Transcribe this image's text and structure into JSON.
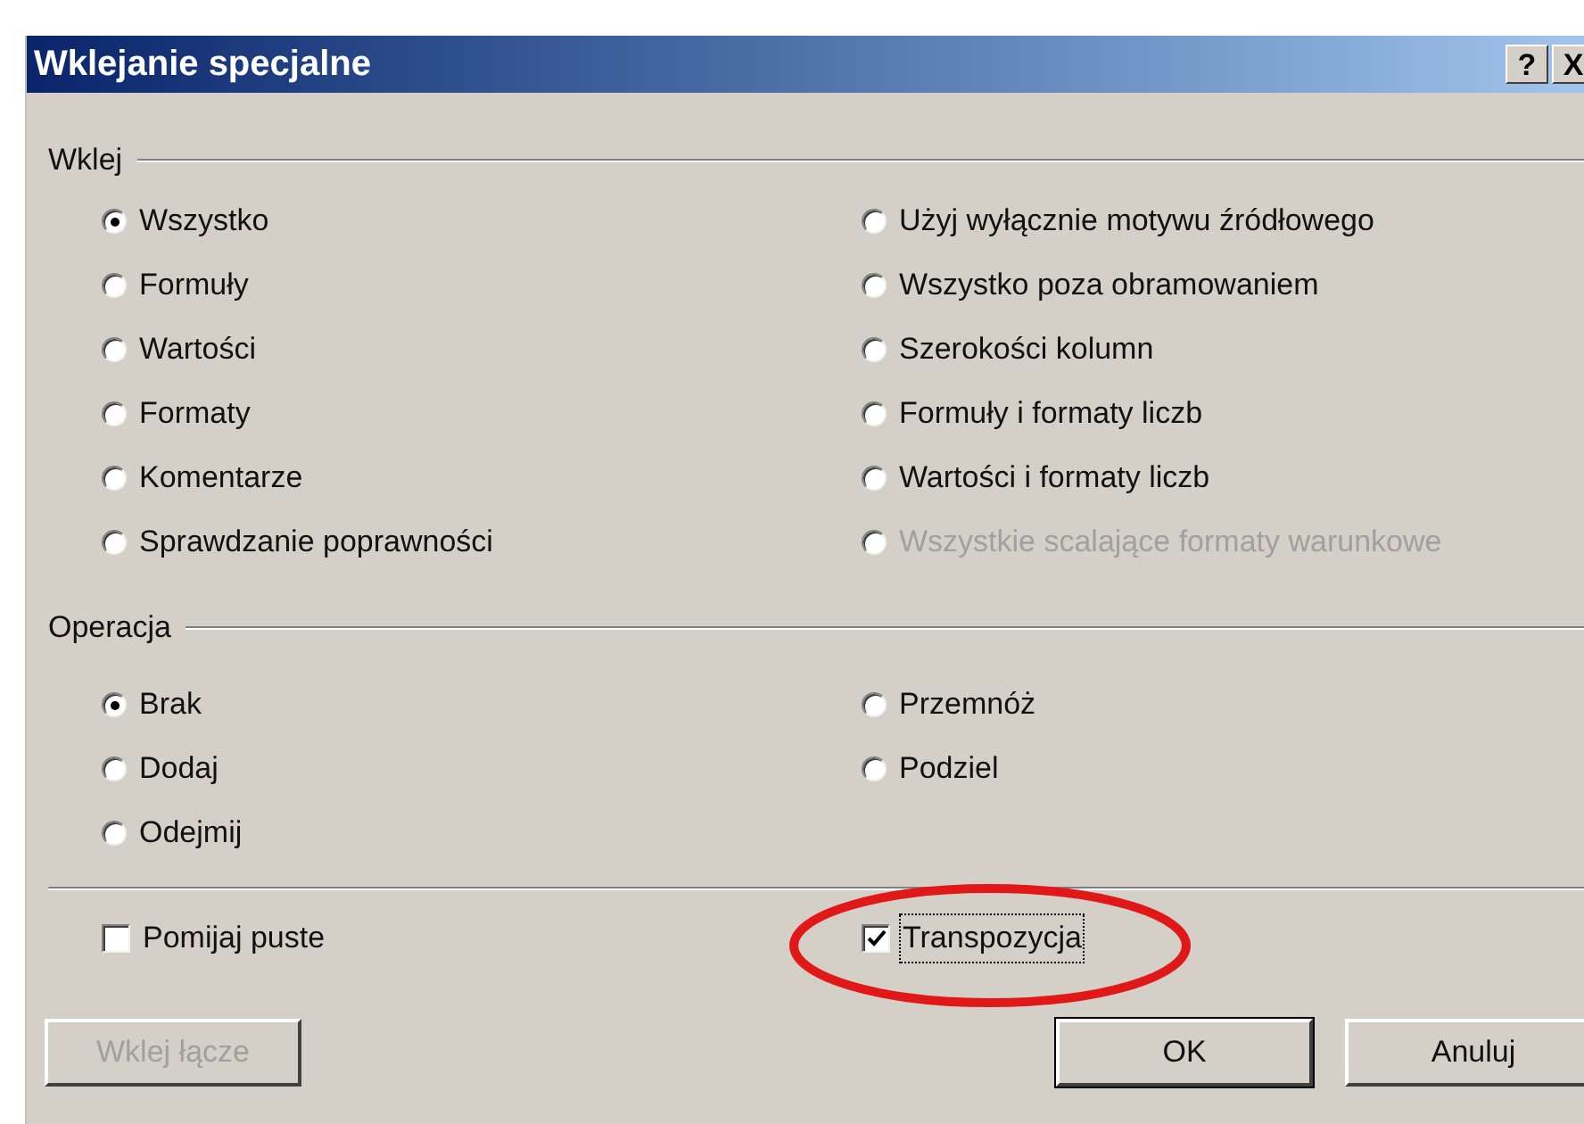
{
  "window": {
    "title": "Wklejanie specjalne",
    "help_button": "?",
    "close_button": "X"
  },
  "paste_group": {
    "label": "Wklej",
    "columns": [
      [
        {
          "label": "Wszystko",
          "selected": true,
          "disabled": false
        },
        {
          "label": "Formuły",
          "selected": false,
          "disabled": false
        },
        {
          "label": "Wartości",
          "selected": false,
          "disabled": false
        },
        {
          "label": "Formaty",
          "selected": false,
          "disabled": false
        },
        {
          "label": "Komentarze",
          "selected": false,
          "disabled": false
        },
        {
          "label": "Sprawdzanie poprawności",
          "selected": false,
          "disabled": false
        }
      ],
      [
        {
          "label": "Użyj wyłącznie motywu źródłowego",
          "selected": false,
          "disabled": false
        },
        {
          "label": "Wszystko poza obramowaniem",
          "selected": false,
          "disabled": false
        },
        {
          "label": "Szerokości kolumn",
          "selected": false,
          "disabled": false
        },
        {
          "label": "Formuły i formaty liczb",
          "selected": false,
          "disabled": false
        },
        {
          "label": "Wartości i formaty liczb",
          "selected": false,
          "disabled": false
        },
        {
          "label": "Wszystkie scalające formaty warunkowe",
          "selected": false,
          "disabled": true
        }
      ]
    ]
  },
  "operation_group": {
    "label": "Operacja",
    "columns": [
      [
        {
          "label": "Brak",
          "selected": true,
          "disabled": false
        },
        {
          "label": "Dodaj",
          "selected": false,
          "disabled": false
        },
        {
          "label": "Odejmij",
          "selected": false,
          "disabled": false
        }
      ],
      [
        {
          "label": "Przemnóż",
          "selected": false,
          "disabled": false
        },
        {
          "label": "Podziel",
          "selected": false,
          "disabled": false
        }
      ]
    ]
  },
  "checkboxes": [
    {
      "label": "Pomijaj puste",
      "checked": false,
      "focused": false,
      "highlighted": false
    },
    {
      "label": "Transpozycja",
      "checked": true,
      "focused": true,
      "highlighted": true
    }
  ],
  "buttons": [
    {
      "label": "Wklej łącze",
      "disabled": true,
      "default": false
    },
    {
      "label": "OK",
      "disabled": false,
      "default": true
    },
    {
      "label": "Anuluj",
      "disabled": false,
      "default": false
    }
  ]
}
